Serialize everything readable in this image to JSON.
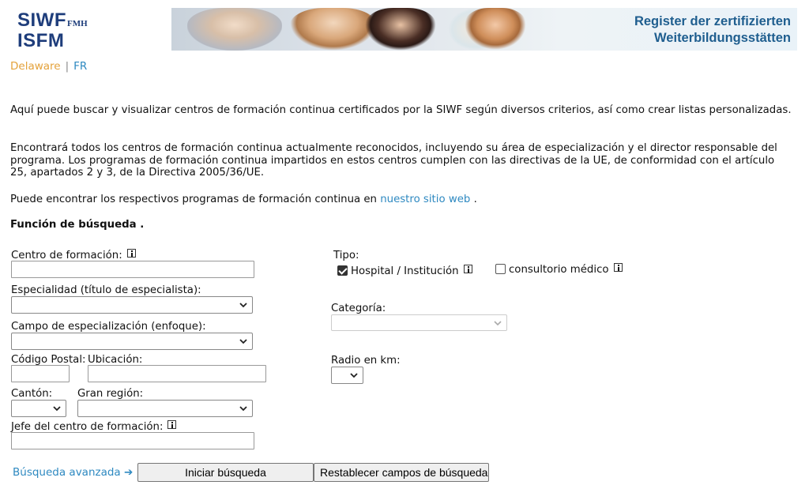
{
  "logo": {
    "line1": "SIWF",
    "line1_small": "FMH",
    "line2": "ISFM"
  },
  "banner": {
    "line1": "Register der zertifizierten",
    "line2": "Weiterbildungsstätten"
  },
  "lang": {
    "current": "Delaware",
    "separator": "|",
    "other": "FR"
  },
  "intro": {
    "p1": "Aquí puede buscar y visualizar centros de formación continua certificados por la SIWF según diversos criterios, así como crear listas personalizadas.",
    "p2": "Encontrará todos los centros de formación continua actualmente reconocidos, incluyendo su área de especialización y el director responsable del programa. Los programas de formación continua impartidos en estos centros cumplen con las directivas de la UE, de conformidad con el artículo 25, apartados 2 y 3, de la Directiva 2005/36/UE.",
    "p3_prefix": "Puede encontrar los respectivos programas de formación continua en",
    "p3_link": "nuestro sitio web",
    "p3_suffix": "."
  },
  "search": {
    "heading": "Función de búsqueda .",
    "centro_label": "Centro de formación:",
    "especialidad_label": "Especialidad (título de especialista):",
    "campo_label": "Campo de especialización (enfoque):",
    "cp_label": "Código Postal:",
    "ubicacion_label": "Ubicación:",
    "canton_label": "Cantón:",
    "region_label": "Gran región:",
    "jefe_label": "Jefe del centro de formación:",
    "tipo_label": "Tipo:",
    "tipo_hospital": "Hospital / Institución",
    "tipo_hospital_checked": true,
    "tipo_consultorio": "consultorio médico",
    "tipo_consultorio_checked": false,
    "categoria_label": "Categoría:",
    "radio_label": "Radio en km:"
  },
  "actions": {
    "advanced": "Búsqueda avanzada",
    "advanced_arrow": "➔",
    "start": "Iniciar búsqueda",
    "reset": "Restablecer campos de búsqueda"
  },
  "icons": [
    "info-icon",
    "chevron-down-icon",
    "checkbox-icon",
    "arrow-right-icon"
  ],
  "colors": {
    "link": "#2e89c1",
    "current_lang": "#e4a23b",
    "logo": "#1e3d7b",
    "banner_text": "#1f5e8f"
  }
}
